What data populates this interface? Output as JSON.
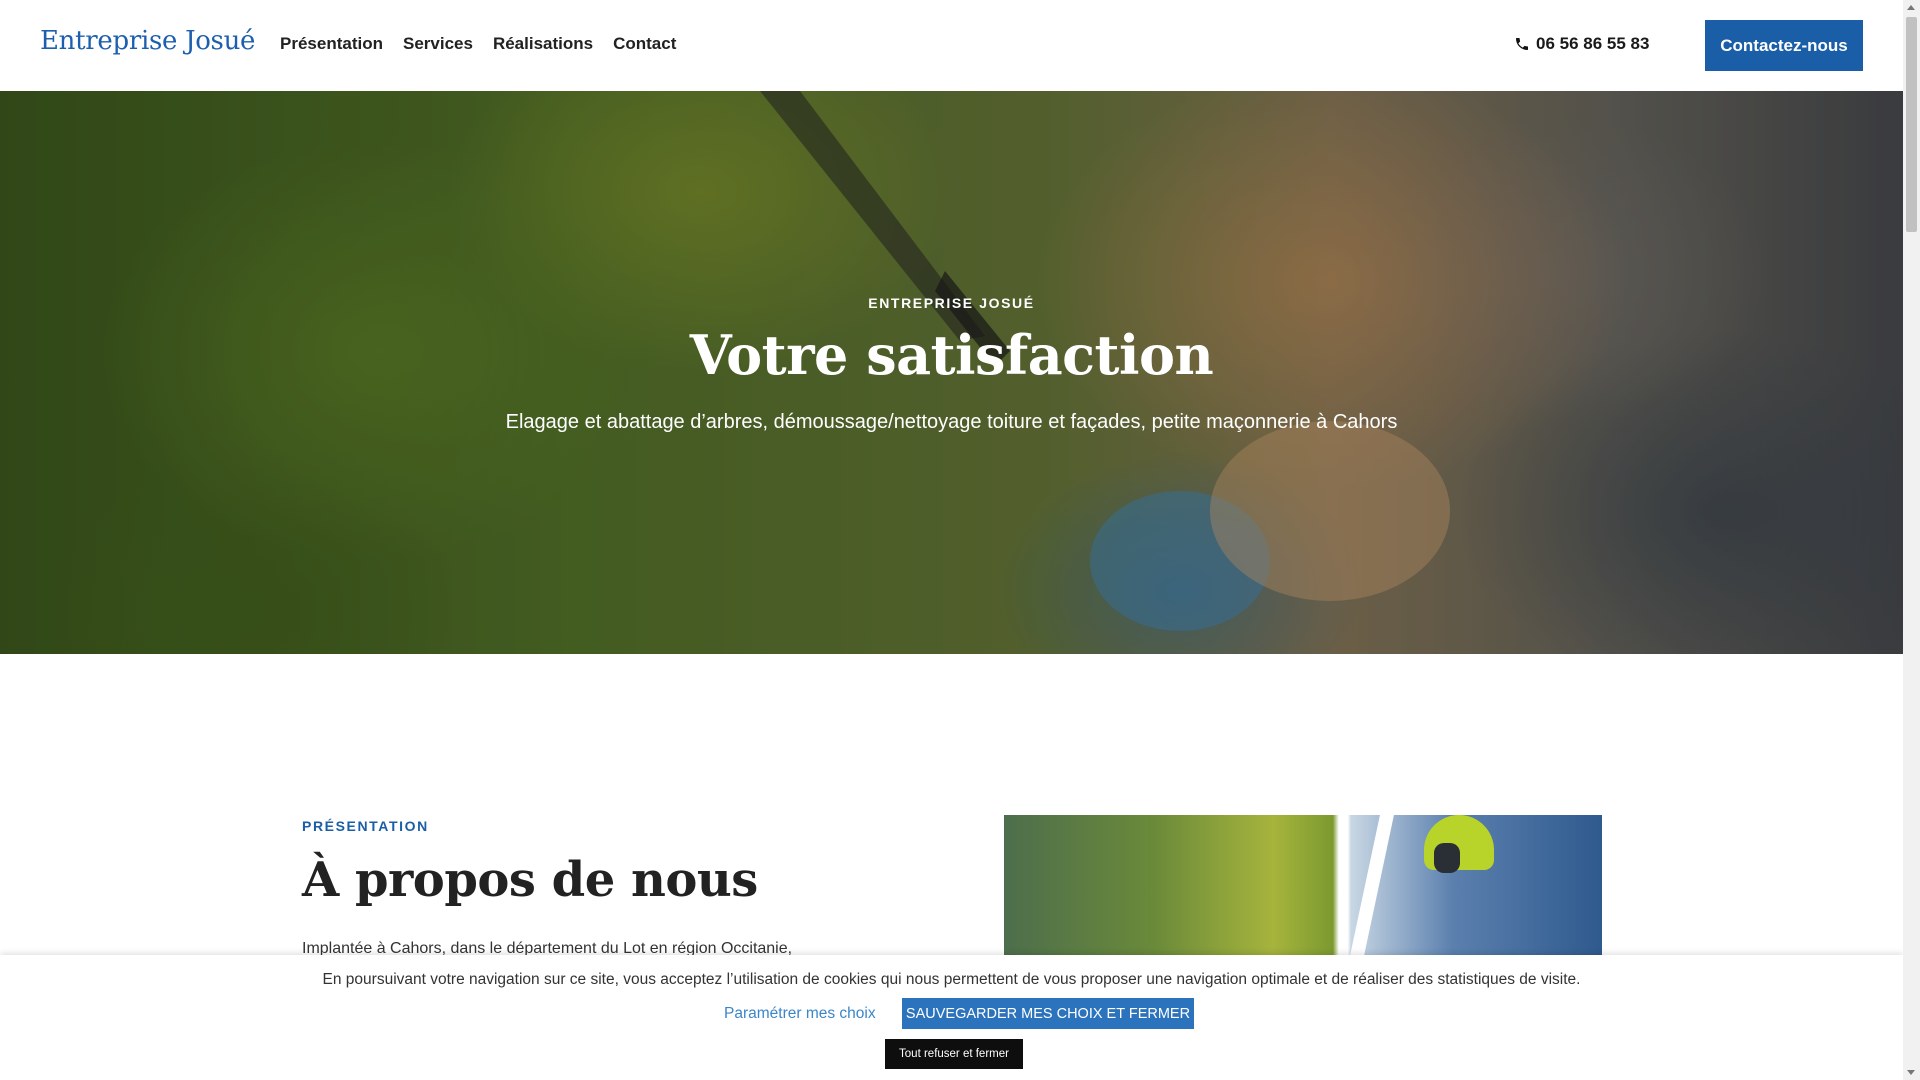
{
  "header": {
    "logo": "Entreprise Josué",
    "nav": [
      "Présentation",
      "Services",
      "Réalisations",
      "Contact"
    ],
    "phone": "06 56 86 55 83",
    "cta": "Contactez-nous"
  },
  "hero": {
    "eyebrow": "ENTREPRISE JOSUÉ",
    "title": "Votre satisfaction",
    "subtitle": "Elagage et abattage d’arbres, démoussage/nettoyage toiture et façades, petite maçonnerie à Cahors"
  },
  "presentation": {
    "eyebrow": "PRÉSENTATION",
    "title": "À propos de nous",
    "text": "Implantée à Cahors, dans le département du Lot en région Occitanie,"
  },
  "cookie": {
    "message": "En poursuivant votre navigation sur ce site, vous acceptez l’utilisation de cookies qui nous permettent de vous proposer une navigation optimale et de réaliser des statistiques de visite.",
    "settings": "Paramétrer mes choix",
    "save": "SAUVEGARDER MES CHOIX ET FERMER",
    "refuse": "Tout refuser et fermer"
  },
  "colors": {
    "brand_blue": "#1a5ea8",
    "link_blue": "#3b86c9",
    "dark": "#0e0e0e"
  },
  "icons": {
    "phone": "phone-icon"
  }
}
